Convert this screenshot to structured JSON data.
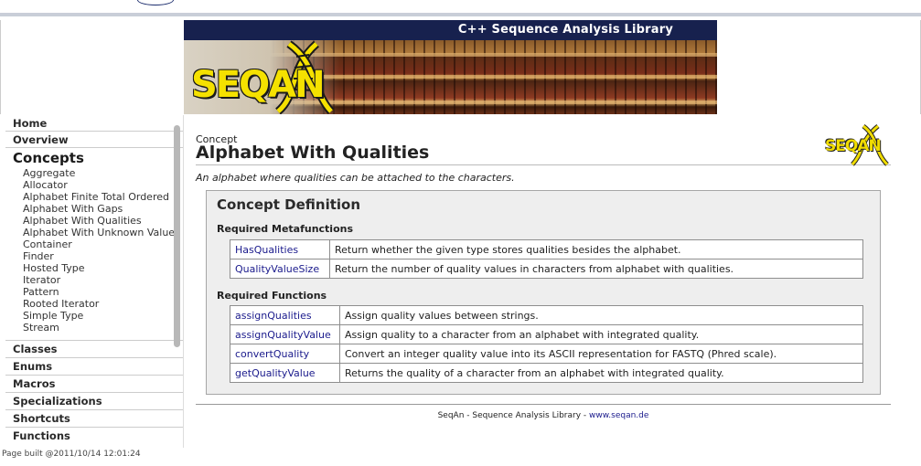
{
  "banner": {
    "title": "C++ Sequence Analysis Library",
    "logo_text": "SEQAN",
    "colors": {
      "bar": "#17214e",
      "logo": "#f5e100"
    }
  },
  "sidebar": {
    "top_links": [
      "Home",
      "Overview"
    ],
    "section_heading": "Concepts",
    "concepts": [
      "Aggregate",
      "Allocator",
      "Alphabet Finite Total Ordered",
      "Alphabet With Gaps",
      "Alphabet With Qualities",
      "Alphabet With Unknown Value",
      "Container",
      "Finder",
      "Hosted Type",
      "Iterator",
      "Pattern",
      "Rooted Iterator",
      "Simple Type",
      "Stream"
    ],
    "bottom_links": [
      "Classes",
      "Enums",
      "Macros",
      "Specializations",
      "Shortcuts",
      "Functions"
    ]
  },
  "page_built": "Page built @2011/10/14 12:01:24",
  "main": {
    "kind": "Concept",
    "title": "Alphabet With Qualities",
    "logo_text": "SEQAN",
    "description": "An alphabet where qualities can be attached to the characters.",
    "definition": {
      "heading": "Concept Definition",
      "metafunctions_heading": "Required Metafunctions",
      "metafunctions": [
        {
          "name": "HasQualities",
          "desc": "Return whether the given type stores qualities besides the alphabet."
        },
        {
          "name": "QualityValueSize",
          "desc": "Return the number of quality values in characters from alphabet with qualities."
        }
      ],
      "functions_heading": "Required Functions",
      "functions": [
        {
          "name": "assignQualities",
          "desc": "Assign quality values between strings."
        },
        {
          "name": "assignQualityValue",
          "desc": "Assign quality to a character from an alphabet with integrated quality."
        },
        {
          "name": "convertQuality",
          "desc": "Convert an integer quality value into its ASCII representation for FASTQ (Phred scale)."
        },
        {
          "name": "getQualityValue",
          "desc": "Returns the quality of a character from an alphabet with integrated quality."
        }
      ]
    },
    "footer": {
      "text": "SeqAn - Sequence Analysis Library - ",
      "link": "www.seqan.de"
    }
  }
}
